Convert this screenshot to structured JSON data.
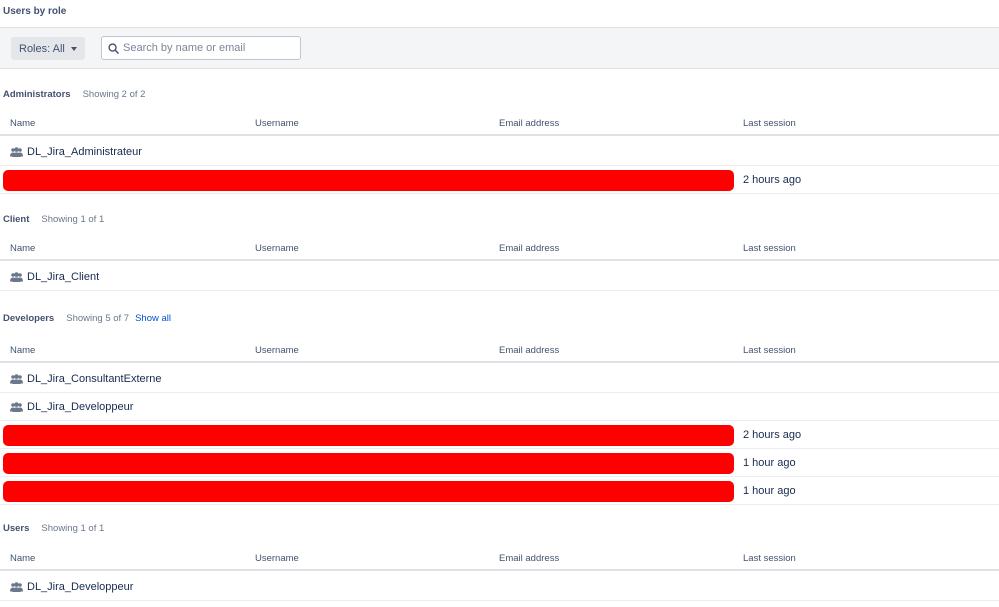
{
  "page": {
    "title": "Users by role"
  },
  "toolbar": {
    "roles_label": "Roles: All",
    "search_placeholder": "Search by name or email"
  },
  "columns": {
    "name": "Name",
    "username": "Username",
    "email": "Email address",
    "last_session": "Last session"
  },
  "colors": {
    "redaction": "#ff0000",
    "link": "#0052cc",
    "toolbar_bg": "#f4f5f7"
  },
  "sections": [
    {
      "title": "Administrators",
      "count": "Showing 2 of 2",
      "rows": [
        {
          "type": "group",
          "icon": "group-icon",
          "name": "DL_Jira_Administrateur"
        },
        {
          "type": "redacted",
          "last_session": "2 hours ago"
        }
      ]
    },
    {
      "title": "Client",
      "count": "Showing 1 of 1",
      "rows": [
        {
          "type": "group",
          "icon": "group-icon",
          "name": "DL_Jira_Client"
        }
      ]
    },
    {
      "title": "Developers",
      "count": "Showing 5 of 7",
      "link": "Show all",
      "rows": [
        {
          "type": "group",
          "icon": "group-icon",
          "name": "DL_Jira_ConsultantExterne"
        },
        {
          "type": "group",
          "icon": "group-icon",
          "name": "DL_Jira_Developpeur"
        },
        {
          "type": "redacted",
          "last_session": "2 hours ago"
        },
        {
          "type": "redacted",
          "last_session": "1 hour ago"
        },
        {
          "type": "redacted",
          "last_session": "1 hour ago"
        }
      ]
    },
    {
      "title": "Users",
      "count": "Showing 1 of 1",
      "rows": [
        {
          "type": "group",
          "icon": "group-icon",
          "name": "DL_Jira_Developpeur"
        }
      ]
    }
  ]
}
